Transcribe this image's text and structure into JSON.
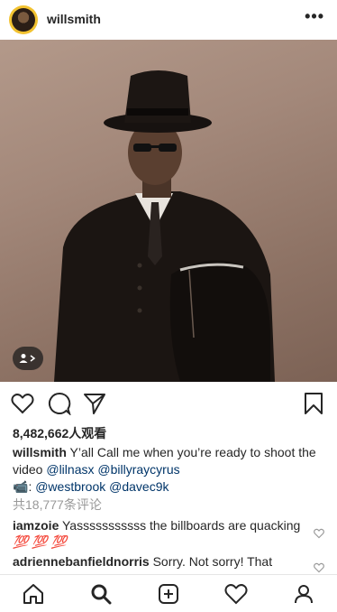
{
  "header": {
    "username": "willsmith",
    "more_label": "•••"
  },
  "post": {
    "image_description_icon": "person-tag-icon",
    "views": "8,482,662人观看",
    "caption": {
      "username": "willsmith",
      "text": "Y’all Call me when you’re ready to shoot the video",
      "mention1": "@lilnasx",
      "mention2": "@billyraycyrus",
      "camera_emoji": "📹",
      "colon": ":",
      "mention3": "@westbrook",
      "mention4": "@davec9k"
    },
    "comments_count": "共18,777条评论",
    "comments": [
      {
        "username": "iamzoie",
        "text": "Yasssssssssss the billboards are quacking",
        "emoji": "💯 💯 💯"
      },
      {
        "username": "adriennebanfieldnorris",
        "text": "Sorry. Not sorry!  That"
      }
    ]
  },
  "colors": {
    "text": "#262626",
    "link": "#003569",
    "muted": "#999999",
    "avatar_ring": "#f2c230"
  },
  "icons": {
    "like": "heart-icon",
    "comment": "comment-bubble-icon",
    "share": "paper-plane-icon",
    "save": "bookmark-icon",
    "nav": [
      "home-icon",
      "search-icon",
      "add-post-icon",
      "activity-heart-icon",
      "profile-icon"
    ]
  }
}
